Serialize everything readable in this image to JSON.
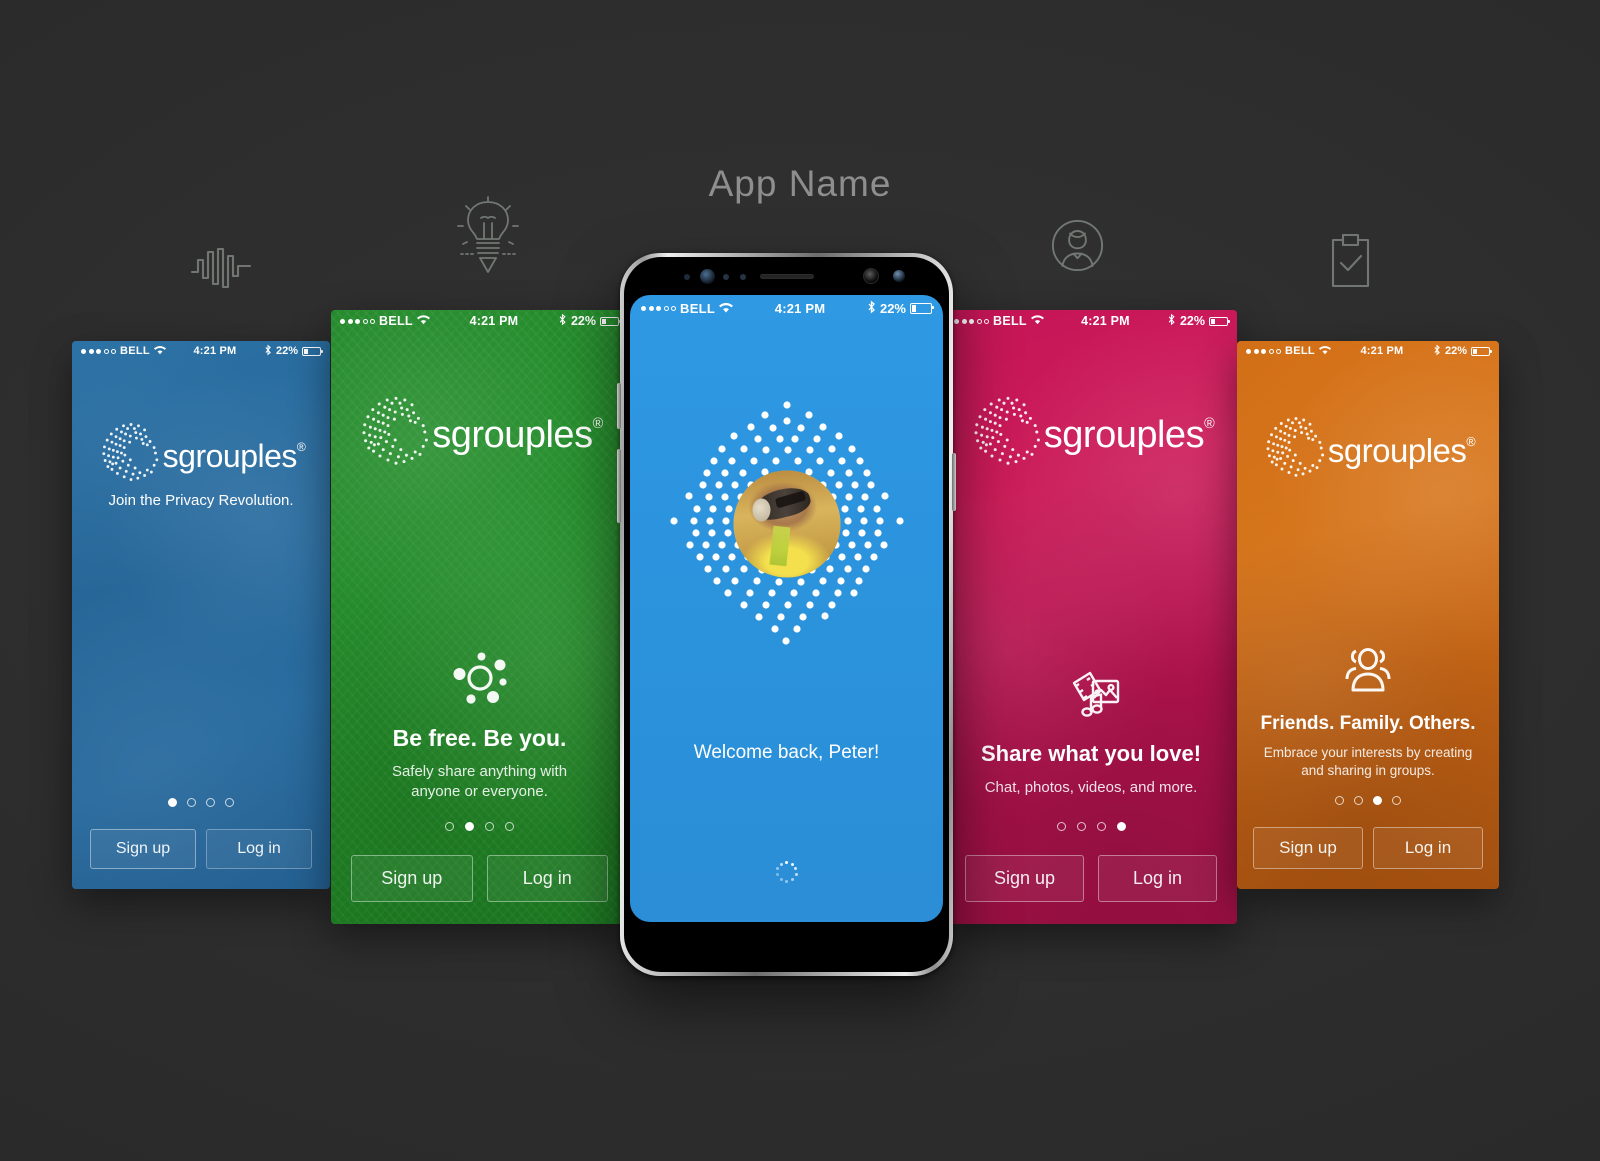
{
  "header": {
    "app_title": "App Name"
  },
  "decor_icons": [
    {
      "name": "waveform-icon",
      "label": "waveform"
    },
    {
      "name": "lightbulb-pencil-icon",
      "label": "idea"
    },
    {
      "name": "user-circle-icon",
      "label": "profile"
    },
    {
      "name": "clipboard-check-icon",
      "label": "checklist"
    }
  ],
  "status_bar": {
    "carrier": "BELL",
    "time": "4:21 PM",
    "battery_percent": "22%",
    "signal_dots_filled": 3,
    "signal_dots_total": 5,
    "wifi_icon": "wifi-icon",
    "bluetooth_icon": "bluetooth-icon",
    "battery_icon": "battery-icon"
  },
  "brand": {
    "wordmark": "sgrouples",
    "registered": "®"
  },
  "colors": {
    "blue": "#2d95df",
    "green": "#2a9a33",
    "pink": "#cf1b5a",
    "orange": "#e07b1e",
    "page_bg": "#2b2b2b",
    "title": "#8e8e8e"
  },
  "buttons": {
    "signup": "Sign up",
    "login": "Log in"
  },
  "screens": [
    {
      "id": "blue",
      "name": "screen-privacy",
      "accent": "#2d95df",
      "tagline": "Join the Privacy Revolution.",
      "headline": "",
      "subline": "",
      "feature_icon": "",
      "dots_total": 4,
      "dots_active": 1
    },
    {
      "id": "green",
      "name": "screen-be-free",
      "accent": "#2a9a33",
      "tagline": "",
      "headline": "Be free. Be you.",
      "subline": "Safely share anything with anyone or everyone.",
      "feature_icon": "share-burst-icon",
      "dots_total": 4,
      "dots_active": 2
    },
    {
      "id": "pink",
      "name": "screen-share",
      "accent": "#cf1b5a",
      "tagline": "",
      "headline": "Share what you love!",
      "subline": "Chat, photos, videos, and more.",
      "feature_icon": "media-collage-icon",
      "dots_total": 4,
      "dots_active": 4
    },
    {
      "id": "orange",
      "name": "screen-groups",
      "accent": "#e07b1e",
      "tagline": "",
      "headline": "Friends. Family. Others.",
      "subline": "Embrace your interests by creating and sharing in groups.",
      "feature_icon": "people-group-icon",
      "dots_total": 4,
      "dots_active": 3
    }
  ],
  "phone": {
    "name": "center-phone",
    "screen_bg": "#2d95df",
    "welcome_text": "Welcome back, Peter!",
    "avatar_alt": "user-avatar",
    "spinner": "loading-spinner"
  }
}
